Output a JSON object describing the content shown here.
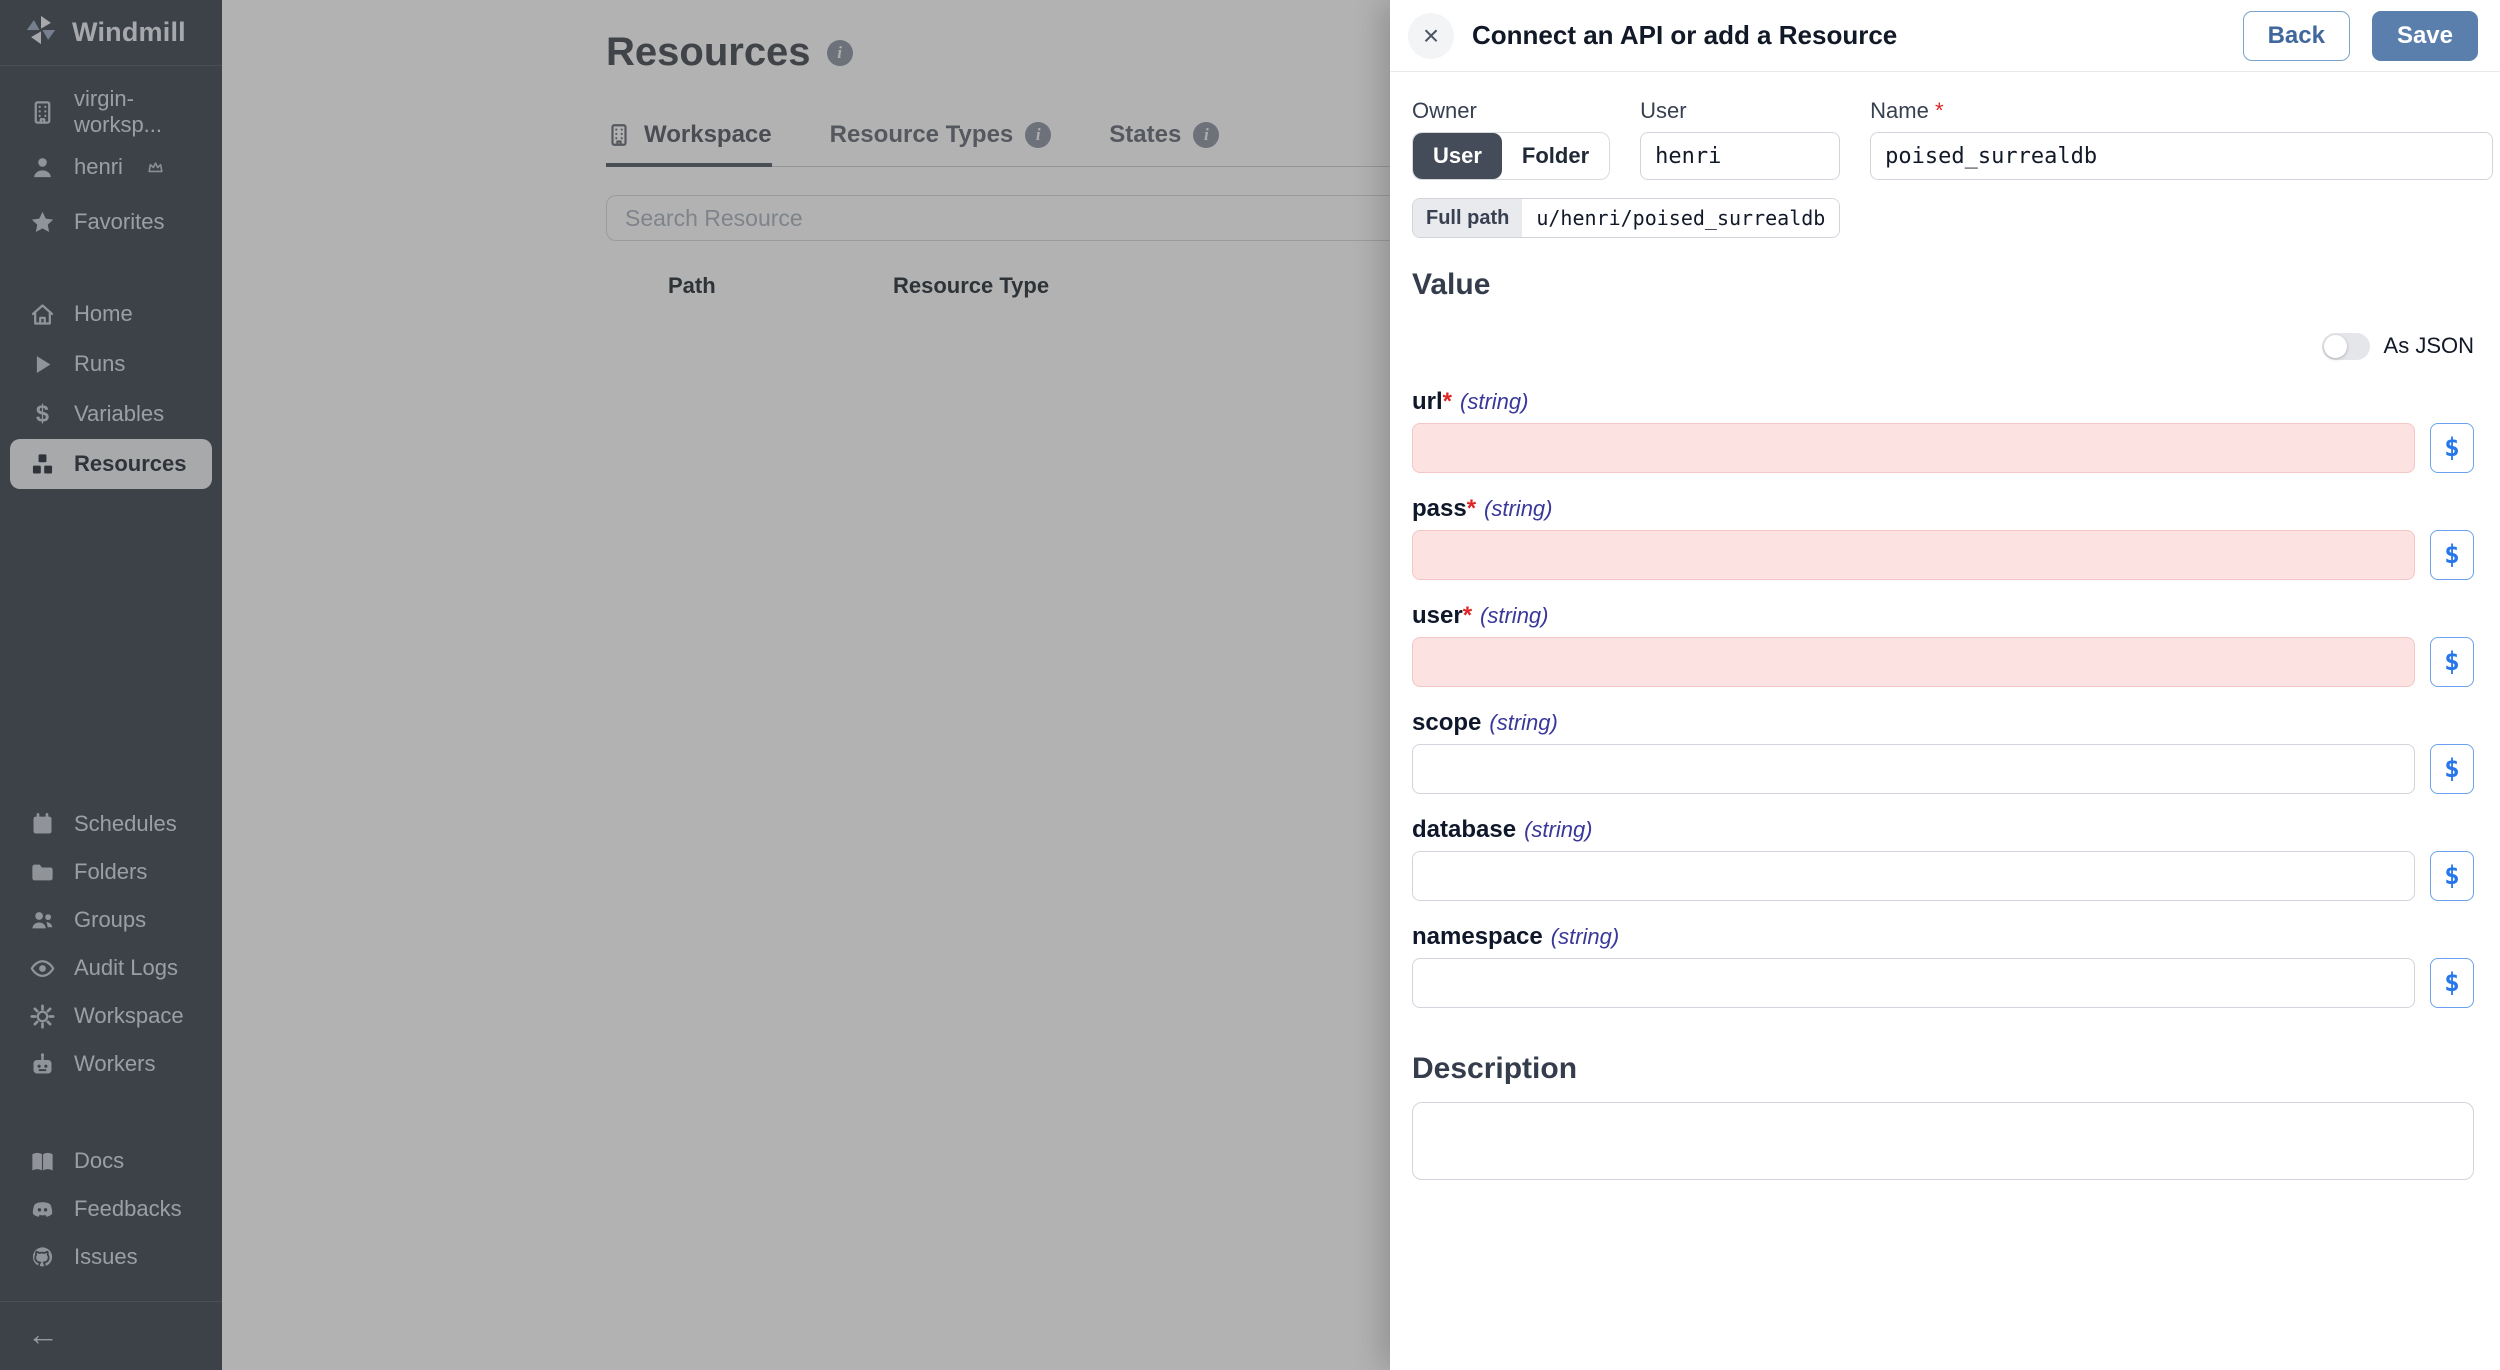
{
  "sidebar": {
    "logo_text": "Windmill",
    "logo_icon": "windmill-pinwheel-icon",
    "top_items": [
      {
        "label": "virgin-worksp...",
        "icon": "building-icon",
        "name": "workspace-switcher",
        "crown": false
      },
      {
        "label": "henri",
        "icon": "user-icon",
        "name": "user-menu",
        "crown": true
      },
      {
        "label": "Favorites",
        "icon": "star-icon",
        "name": "favorites",
        "crown": false
      }
    ],
    "main_nav": [
      {
        "label": "Home",
        "icon": "home-icon",
        "name": "sidebar-item-home",
        "active": false
      },
      {
        "label": "Runs",
        "icon": "play-icon",
        "name": "sidebar-item-runs",
        "active": false
      },
      {
        "label": "Variables",
        "icon": "dollar-icon",
        "name": "sidebar-item-variables",
        "active": false
      },
      {
        "label": "Resources",
        "icon": "cubes-icon",
        "name": "sidebar-item-resources",
        "active": true
      }
    ],
    "admin_nav": [
      {
        "label": "Schedules",
        "icon": "calendar-icon",
        "name": "sidebar-item-schedules"
      },
      {
        "label": "Folders",
        "icon": "folder-icon",
        "name": "sidebar-item-folders"
      },
      {
        "label": "Groups",
        "icon": "users-icon",
        "name": "sidebar-item-groups"
      },
      {
        "label": "Audit Logs",
        "icon": "eye-icon",
        "name": "sidebar-item-audit-logs"
      },
      {
        "label": "Workspace",
        "icon": "gear-icon",
        "name": "sidebar-item-workspace"
      },
      {
        "label": "Workers",
        "icon": "robot-icon",
        "name": "sidebar-item-workers"
      }
    ],
    "footer_nav": [
      {
        "label": "Docs",
        "icon": "book-icon",
        "name": "sidebar-item-docs"
      },
      {
        "label": "Feedbacks",
        "icon": "discord-icon",
        "name": "sidebar-item-feedbacks"
      },
      {
        "label": "Issues",
        "icon": "github-icon",
        "name": "sidebar-item-issues"
      }
    ],
    "collapse_arrow": "←"
  },
  "main": {
    "title": "Resources",
    "tabs": [
      {
        "label": "Workspace",
        "icon": "building-icon",
        "info": false,
        "active": true
      },
      {
        "label": "Resource Types",
        "icon": null,
        "info": true,
        "active": false
      },
      {
        "label": "States",
        "icon": null,
        "info": true,
        "active": false
      }
    ],
    "search_placeholder": "Search Resource",
    "table_headers": {
      "path": "Path",
      "resource_type": "Resource Type"
    }
  },
  "drawer": {
    "title": "Connect an API or add a Resource",
    "close_label": "×",
    "back_label": "Back",
    "save_label": "Save",
    "owner": {
      "label": "Owner",
      "options": [
        "User",
        "Folder"
      ],
      "selected": "User"
    },
    "user_field": {
      "label": "User",
      "value": "henri"
    },
    "name_field": {
      "label": "Name",
      "required": true,
      "value": "poised_surrealdb"
    },
    "full_path": {
      "label": "Full path",
      "value": "u/henri/poised_surrealdb"
    },
    "value_section": {
      "heading": "Value",
      "as_json_label": "As JSON",
      "as_json_on": false
    },
    "fields": [
      {
        "name": "url",
        "type": "(string)",
        "required": true,
        "value": ""
      },
      {
        "name": "pass",
        "type": "(string)",
        "required": true,
        "value": ""
      },
      {
        "name": "user",
        "type": "(string)",
        "required": true,
        "value": ""
      },
      {
        "name": "scope",
        "type": "(string)",
        "required": false,
        "value": ""
      },
      {
        "name": "database",
        "type": "(string)",
        "required": false,
        "value": ""
      },
      {
        "name": "namespace",
        "type": "(string)",
        "required": false,
        "value": ""
      }
    ],
    "dollar_button_label": "$",
    "description": {
      "heading": "Description",
      "value": ""
    }
  },
  "colors": {
    "sidebar_bg": "#585f69",
    "save_button": "#5b7fad",
    "invalid_field_bg": "#fde2e2",
    "dollar_accent": "#2777ea",
    "required_star": "#dc2626",
    "type_annotation": "#3a389a"
  }
}
